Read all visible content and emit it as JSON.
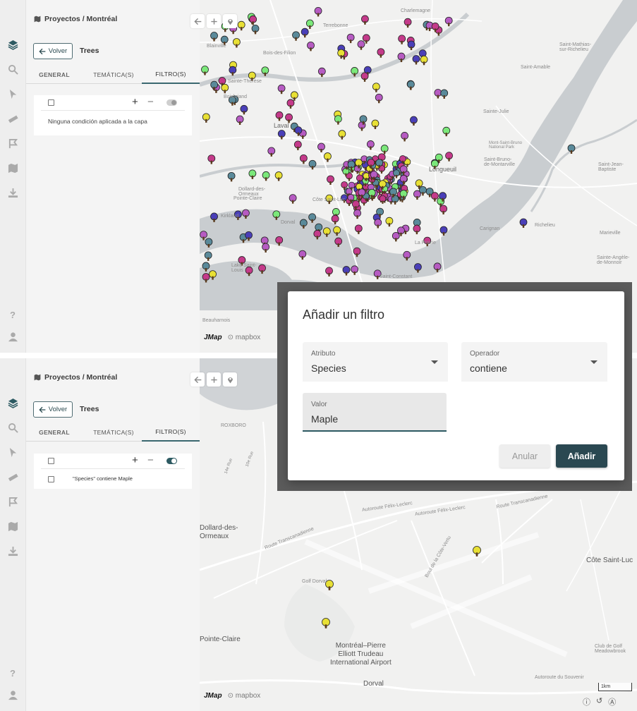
{
  "breadcrumb": "Proyectos / Montréal",
  "back_label": "Volver",
  "layer_name": "Trees",
  "tabs": {
    "general": "GENERAL",
    "tematica": "TEMÁTICA(S)",
    "filtros": "FILTRO(S)"
  },
  "top_panel": {
    "empty_message": "Ninguna condición aplicada a la capa"
  },
  "bottom_panel": {
    "condition": "\"Species\" contiene Maple"
  },
  "map_brand": {
    "jmap": "JMap",
    "mapbox": "mapbox"
  },
  "top_map_labels": {
    "terrebonne": "Terrebonne",
    "charlemagne": "Charlemagne",
    "blainville": "Blainville",
    "bois_des_filion": "Bois-des-Filion",
    "saint_mathias": "Saint-Mathias-\nsur-Richelieu",
    "sainte_therese": "Sainte-Thérèse",
    "boisbriand": "Boisbriand",
    "saint_amable": "Saint-Amable",
    "laval": "Laval",
    "sainte_julie": "Sainte-Julie",
    "saint_jean_baptiste": "Saint-Jean-\nBaptiste",
    "mont_saint_bruno": "Mont-Saint-Bruno\nNational Park",
    "saint_bruno": "Saint-Bruno-\nde-Montarville",
    "longueuil": "Longueuil",
    "dollard": "Dollard-des-\nOrmeaux",
    "pointe_claire": "Pointe-Claire",
    "cote_saint_luc": "Côte Saint-Luc",
    "kirkland": "Kirkland",
    "dorval": "Dorval",
    "carignan": "Carignan",
    "richelieu": "Richelieu",
    "marieville": "Marieville",
    "la_prairie": "La Prairie",
    "lake_saint_louis": "Lake Saint-\nLouis",
    "saint_constant": "Saint-Constant",
    "beauharnois": "Beauharnois",
    "sainte_angele": "Sainte-Angèle-\nde-Monnoir"
  },
  "bottom_map_labels": {
    "roxboro": "ROXBORO",
    "rue14": "14e Rue",
    "rue10": "10e Rue",
    "dollard": "Dollard-des-\nOrmeaux",
    "pointe_claire": "Pointe-Claire",
    "cote_saint_luc": "Côte Saint-Luc",
    "airport": "Montréal–Pierre\nElliott Trudeau\nInternational Airport",
    "dorval": "Dorval",
    "golf_dorval": "Golf Dorval",
    "club_golf": "Club de Golf\nMeadowbrook",
    "autoroute_felix": "Autoroute Félix-Leclerc",
    "route_trans": "Route Transcanadienne",
    "autoroute_souvenir": "Autoroute du Souvenir",
    "boul_cote_vertu": "Boul de la Côte-Vertu"
  },
  "dialog": {
    "title": "Añadir un filtro",
    "attribute_label": "Atributo",
    "attribute_value": "Species",
    "operator_label": "Operador",
    "operator_value": "contiene",
    "value_label": "Valor",
    "value_value": "Maple",
    "cancel": "Anular",
    "add": "Añadir"
  },
  "scale": "1km",
  "colors": {
    "accent": "#2d5a62",
    "button_dark": "#2a4851",
    "tree_yellow": "#e8e035",
    "tree_purple": "#b65bc2",
    "tree_blue": "#4a3fb8",
    "tree_magenta": "#c43a8a",
    "tree_green": "#7be87a",
    "tree_teal": "#5a8a9a"
  }
}
